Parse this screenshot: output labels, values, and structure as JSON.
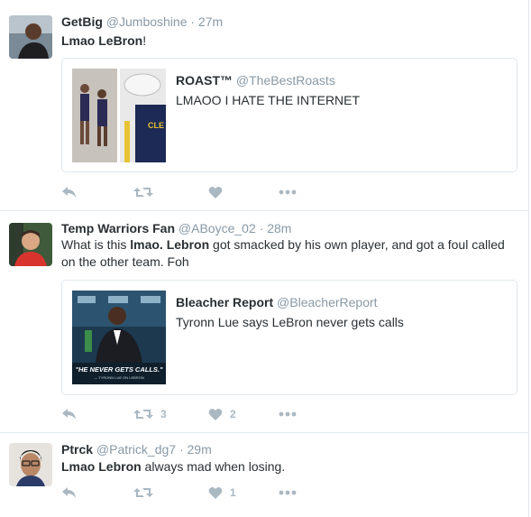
{
  "tweets": [
    {
      "name": "GetBig",
      "handle": "@Jumboshine",
      "time": "· 27m",
      "text_html": "<b>Lmao LeBron</b>!",
      "card": {
        "name": "ROAST™",
        "handle": "@TheBestRoasts",
        "text": "LMAOO I HATE THE INTERNET"
      },
      "retweets": "",
      "likes": ""
    },
    {
      "name": "Temp Warriors Fan",
      "handle": "@ABoyce_02",
      "time": "· 28m",
      "text_html": "What is this <b>lmao. Lebron</b> got smacked by his own player, and got a foul called on the other team. Foh",
      "card": {
        "name": "Bleacher Report",
        "handle": "@BleacherReport",
        "text": "Tyronn Lue says LeBron never gets calls",
        "image_caption": "\"HE NEVER GETS CALLS.\"",
        "image_subcaption": "— TYRONN LUE ON LEBRON"
      },
      "retweets": "3",
      "likes": "2"
    },
    {
      "name": "Ptrck",
      "handle": "@Patrick_dg7",
      "time": "· 29m",
      "text_html": "<b>Lmao Lebron</b> always mad when losing.",
      "retweets": "",
      "likes": "1"
    }
  ],
  "icons": {
    "reply": "reply-icon",
    "retweet": "retweet-icon",
    "like": "heart-icon",
    "more": "more-icon"
  },
  "colors": {
    "action_gray": "#aab8c2",
    "meta_gray": "#8899a6",
    "border": "#e1e8ed",
    "text": "#292f33"
  }
}
